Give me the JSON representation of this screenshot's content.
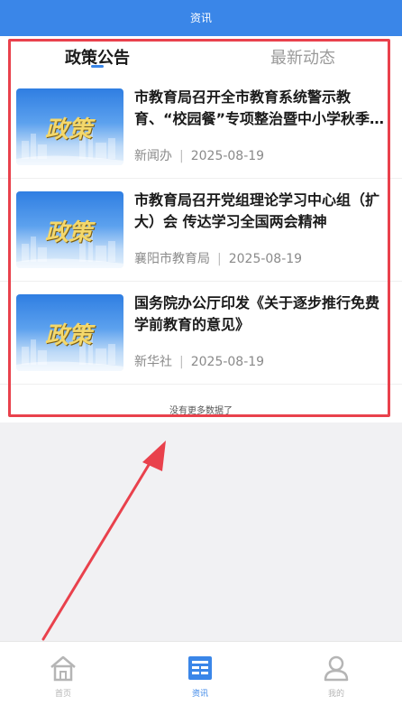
{
  "header": {
    "title": "资讯"
  },
  "tabs": [
    {
      "label": "政策公告",
      "active": true
    },
    {
      "label": "最新动态",
      "active": false
    }
  ],
  "thumbnail_text": "政策",
  "news": [
    {
      "title": "市教育局召开全市教育系统警示教育、“校园餐”专项整治暨中小学秋季开…",
      "source": "新闻办",
      "date": "2025-08-19"
    },
    {
      "title": "市教育局召开党组理论学习中心组（扩大）会 传达学习全国两会精神",
      "source": "襄阳市教育局",
      "date": "2025-08-19"
    },
    {
      "title": "国务院办公厅印发《关于逐步推行免费学前教育的意见》",
      "source": "新华社",
      "date": "2025-08-19"
    }
  ],
  "no_more_text": "没有更多数据了",
  "bottom_nav": [
    {
      "label": "首页",
      "icon": "home-icon",
      "active": false
    },
    {
      "label": "资讯",
      "icon": "news-icon",
      "active": true
    },
    {
      "label": "我的",
      "icon": "user-icon",
      "active": false
    }
  ],
  "colors": {
    "accent": "#3a86e8",
    "highlight": "#e9414c"
  }
}
